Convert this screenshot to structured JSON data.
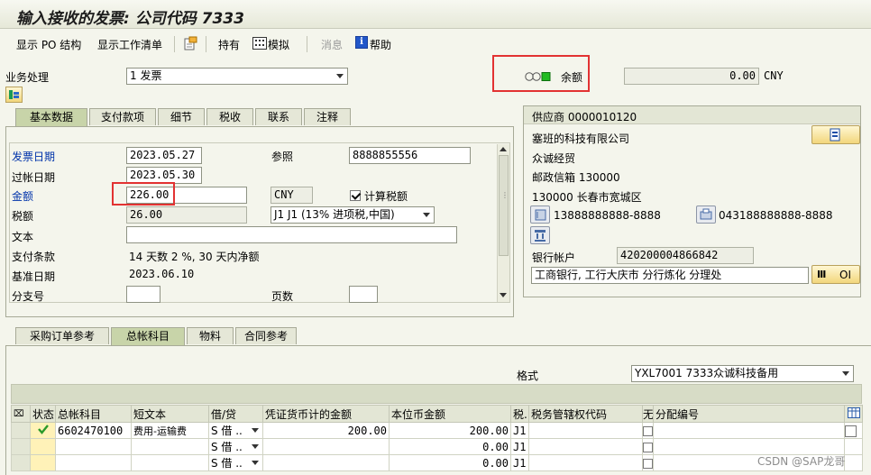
{
  "window": {
    "title": "输入接收的发票: 公司代码 7333"
  },
  "toolbar": {
    "show_po_structure": "显示 PO 结构",
    "show_worklist": "显示工作清单",
    "hold": "持有",
    "simulate": "模拟",
    "messages": "消息",
    "help": "帮助"
  },
  "header": {
    "transaction_label": "业务处理",
    "transaction_value": "1 发票",
    "balance_label": "余额",
    "balance_value": "0.00",
    "balance_currency": "CNY",
    "status_light": {
      "red": "#c8c8c8",
      "yellow": "#c8c8c8",
      "green": "#22bb22"
    }
  },
  "basic_tabs": [
    "基本数据",
    "支付款项",
    "细节",
    "税收",
    "联系",
    "注释"
  ],
  "basic_data": {
    "invoice_date_label": "发票日期",
    "invoice_date": "2023.05.27",
    "reference_label": "参照",
    "reference": "8888855556",
    "posting_date_label": "过帐日期",
    "posting_date": "2023.05.30",
    "amount_label": "金额",
    "amount": "226.00",
    "currency": "CNY",
    "calc_tax_label": "计算税额",
    "calc_tax_checked": true,
    "tax_amount_label": "税额",
    "tax_amount": "26.00",
    "tax_code": "J1 J1 (13% 进项税,中国)",
    "text_label": "文本",
    "text": "",
    "payment_terms_label": "支付条款",
    "payment_terms": "14 天数 2 %, 30 天内净额",
    "baseline_date_label": "基准日期",
    "baseline_date": "2023.06.10",
    "business_place_label": "分支号",
    "business_place": "",
    "page_label": "页数",
    "page": ""
  },
  "vendor": {
    "title": "供应商 0000010120",
    "name": "塞班的科技有限公司",
    "name2": "众诚经贸",
    "po_box": "邮政信箱 130000",
    "city": "130000 长春市宽城区",
    "phone": "13888888888-8888",
    "fax": "043188888888-8888",
    "bank_account_label": "银行帐户",
    "bank_account": "420200004866842",
    "bank_name": "工商银行, 工行大庆市 分行炼化 分理处",
    "oi_label": "OI"
  },
  "item_tabs": [
    "采购订单参考",
    "总帐科目",
    "物料",
    "合同参考"
  ],
  "layout_label": "格式",
  "layout_value": "YXL7001 7333众诚科技备用",
  "gl_table": {
    "columns": [
      "状态",
      "总帐科目",
      "短文本",
      "借/贷",
      "凭证货币计的金额",
      "本位币金额",
      "税.",
      "税务管辖权代码",
      "无",
      "分配编号"
    ],
    "rows": [
      {
        "status": "ok",
        "account": "6602470100",
        "text": "费用-运输费",
        "dc": "S 借 ..",
        "amount": "200.00",
        "local_amount": "200.00",
        "tax": "J1",
        "jurisdiction": "",
        "assignment": ""
      },
      {
        "status": "",
        "account": "",
        "text": "",
        "dc": "S 借 ..",
        "amount": "",
        "local_amount": "0.00",
        "tax": "J1",
        "jurisdiction": "",
        "assignment": ""
      },
      {
        "status": "",
        "account": "",
        "text": "",
        "dc": "S 借 ..",
        "amount": "",
        "local_amount": "0.00",
        "tax": "J1",
        "jurisdiction": "",
        "assignment": ""
      }
    ]
  },
  "watermark": "CSDN @SAP龙哥"
}
